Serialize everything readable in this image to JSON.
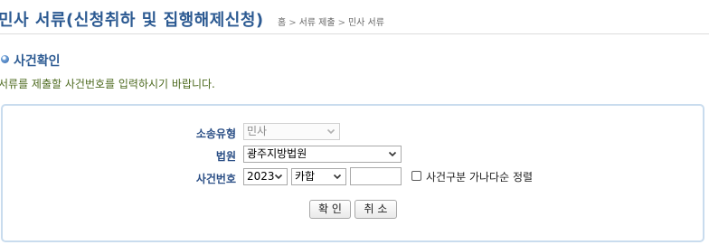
{
  "header": {
    "title": "민사 서류(신청취하 및 집행해제신청)",
    "breadcrumb": [
      "홈",
      "서류 제출",
      "민사 서류"
    ],
    "breadcrumb_separator": ">"
  },
  "section": {
    "title": "사건확인",
    "instruction": "서류를 제출할 사건번호를 입력하시기 바랍니다."
  },
  "form": {
    "case_type": {
      "label": "소송유형",
      "value": "민사",
      "disabled": true
    },
    "court": {
      "label": "법원",
      "value": "광주지방법원"
    },
    "case_number": {
      "label": "사건번호",
      "year": "2023",
      "category": "카합",
      "number_value": "",
      "sort_option": {
        "label": "사건구분 가나다순 정렬",
        "checked": false
      }
    },
    "buttons": {
      "confirm": "확 인",
      "cancel": "취 소"
    }
  },
  "colors": {
    "title": "#2c5a92",
    "instruction": "#4d6a1f",
    "label": "#2b4f86",
    "box_border": "#c9dcee"
  }
}
